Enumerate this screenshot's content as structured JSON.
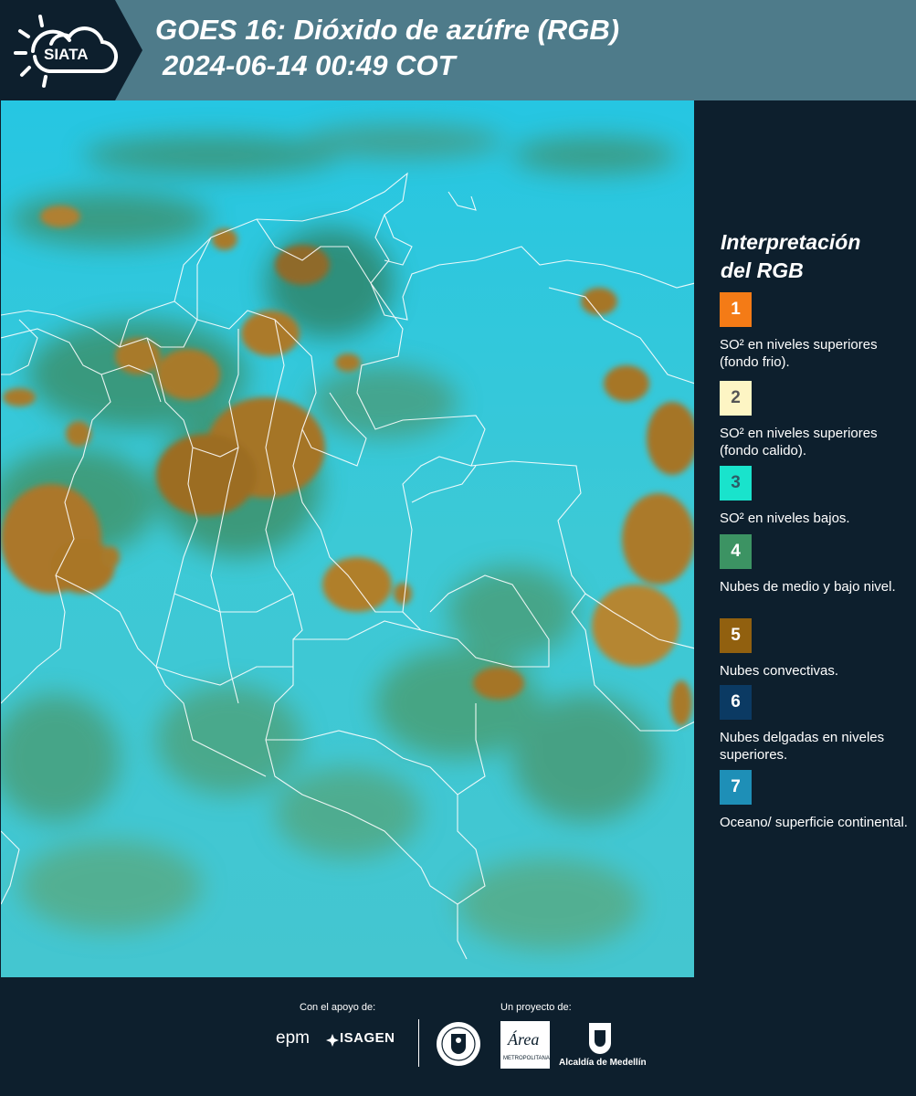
{
  "header": {
    "logo_text": "SIATA",
    "title_line1": "GOES 16: Dióxido de azúfre (RGB)",
    "title_line2": "2024-06-14 00:49 COT"
  },
  "legend": {
    "title_line1": "Interpretación",
    "title_line2": "del RGB",
    "items": [
      {
        "number": "1",
        "color": "#f47b16",
        "text_color": "#ffffff",
        "label": "SO² en niveles superiores (fondo frio)."
      },
      {
        "number": "2",
        "color": "#fdf5c4",
        "text_color": "#555555",
        "label": "SO² en niveles superiores (fondo calido)."
      },
      {
        "number": "3",
        "color": "#19e3cc",
        "text_color": "#2c5d67",
        "label": "SO² en niveles bajos."
      },
      {
        "number": "4",
        "color": "#3c9363",
        "text_color": "#ffffff",
        "label": "Nubes de medio y bajo nivel."
      },
      {
        "number": "5",
        "color": "#91600f",
        "text_color": "#ffffff",
        "label": "Nubes convectivas."
      },
      {
        "number": "6",
        "color": "#0b3a63",
        "text_color": "#ffffff",
        "label": "Nubes delgadas en niveles superiores."
      },
      {
        "number": "7",
        "color": "#1e8fb7",
        "text_color": "#ffffff",
        "label": "Oceano/ superficie continental."
      }
    ]
  },
  "footer": {
    "support_label": "Con el apoyo de:",
    "project_label": "Un proyecto de:",
    "sponsor_epm": "epm",
    "sponsor_isagen": "ISAGEN",
    "area_logo_text": "Área",
    "area_sub_text": "METROPOLITANA",
    "alcaldia": "Alcaldía de Medellín"
  },
  "colors": {
    "background": "#0d1f2d",
    "header_band": "#4e7b8a",
    "ocean_cyan": "#35c3d7",
    "convective_cloud": "#a8772a",
    "mid_low_cloud": "#3f8f5a"
  }
}
